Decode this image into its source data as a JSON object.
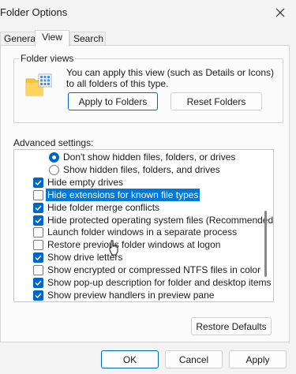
{
  "window": {
    "title": "Folder Options",
    "close_icon": "close-icon"
  },
  "tabs": [
    {
      "label": "General",
      "active": false
    },
    {
      "label": "View",
      "active": true
    },
    {
      "label": "Search",
      "active": false
    }
  ],
  "folder_views": {
    "legend": "Folder views",
    "icon": "folder-view-icon",
    "description": "You can apply this view (such as Details or Icons) to all folders of this type.",
    "apply_label": "Apply to Folders",
    "reset_label": "Reset Folders"
  },
  "advanced": {
    "label": "Advanced settings:",
    "items": [
      {
        "type": "radio",
        "checked": true,
        "label": "Don't show hidden files, folders, or drives",
        "indent": 1
      },
      {
        "type": "radio",
        "checked": false,
        "label": "Show hidden files, folders, and drives",
        "indent": 1
      },
      {
        "type": "checkbox",
        "checked": true,
        "label": "Hide empty drives",
        "indent": 0
      },
      {
        "type": "checkbox",
        "checked": false,
        "label": "Hide extensions for known file types",
        "indent": 0,
        "selected": true
      },
      {
        "type": "checkbox",
        "checked": true,
        "label": "Hide folder merge conflicts",
        "indent": 0
      },
      {
        "type": "checkbox",
        "checked": true,
        "label": "Hide protected operating system files (Recommended)",
        "indent": 0
      },
      {
        "type": "checkbox",
        "checked": false,
        "label": "Launch folder windows in a separate process",
        "indent": 0
      },
      {
        "type": "checkbox",
        "checked": false,
        "label": "Restore previous folder windows at logon",
        "indent": 0
      },
      {
        "type": "checkbox",
        "checked": true,
        "label": "Show drive letters",
        "indent": 0
      },
      {
        "type": "checkbox",
        "checked": false,
        "label": "Show encrypted or compressed NTFS files in color",
        "indent": 0
      },
      {
        "type": "checkbox",
        "checked": true,
        "label": "Show pop-up description for folder and desktop items",
        "indent": 0
      },
      {
        "type": "checkbox",
        "checked": true,
        "label": "Show preview handlers in preview pane",
        "indent": 0
      }
    ],
    "restore_label": "Restore Defaults"
  },
  "footer": {
    "ok_label": "OK",
    "cancel_label": "Cancel",
    "apply_label": "Apply"
  },
  "colors": {
    "accent": "#0067c0",
    "selection": "#0078d7"
  }
}
